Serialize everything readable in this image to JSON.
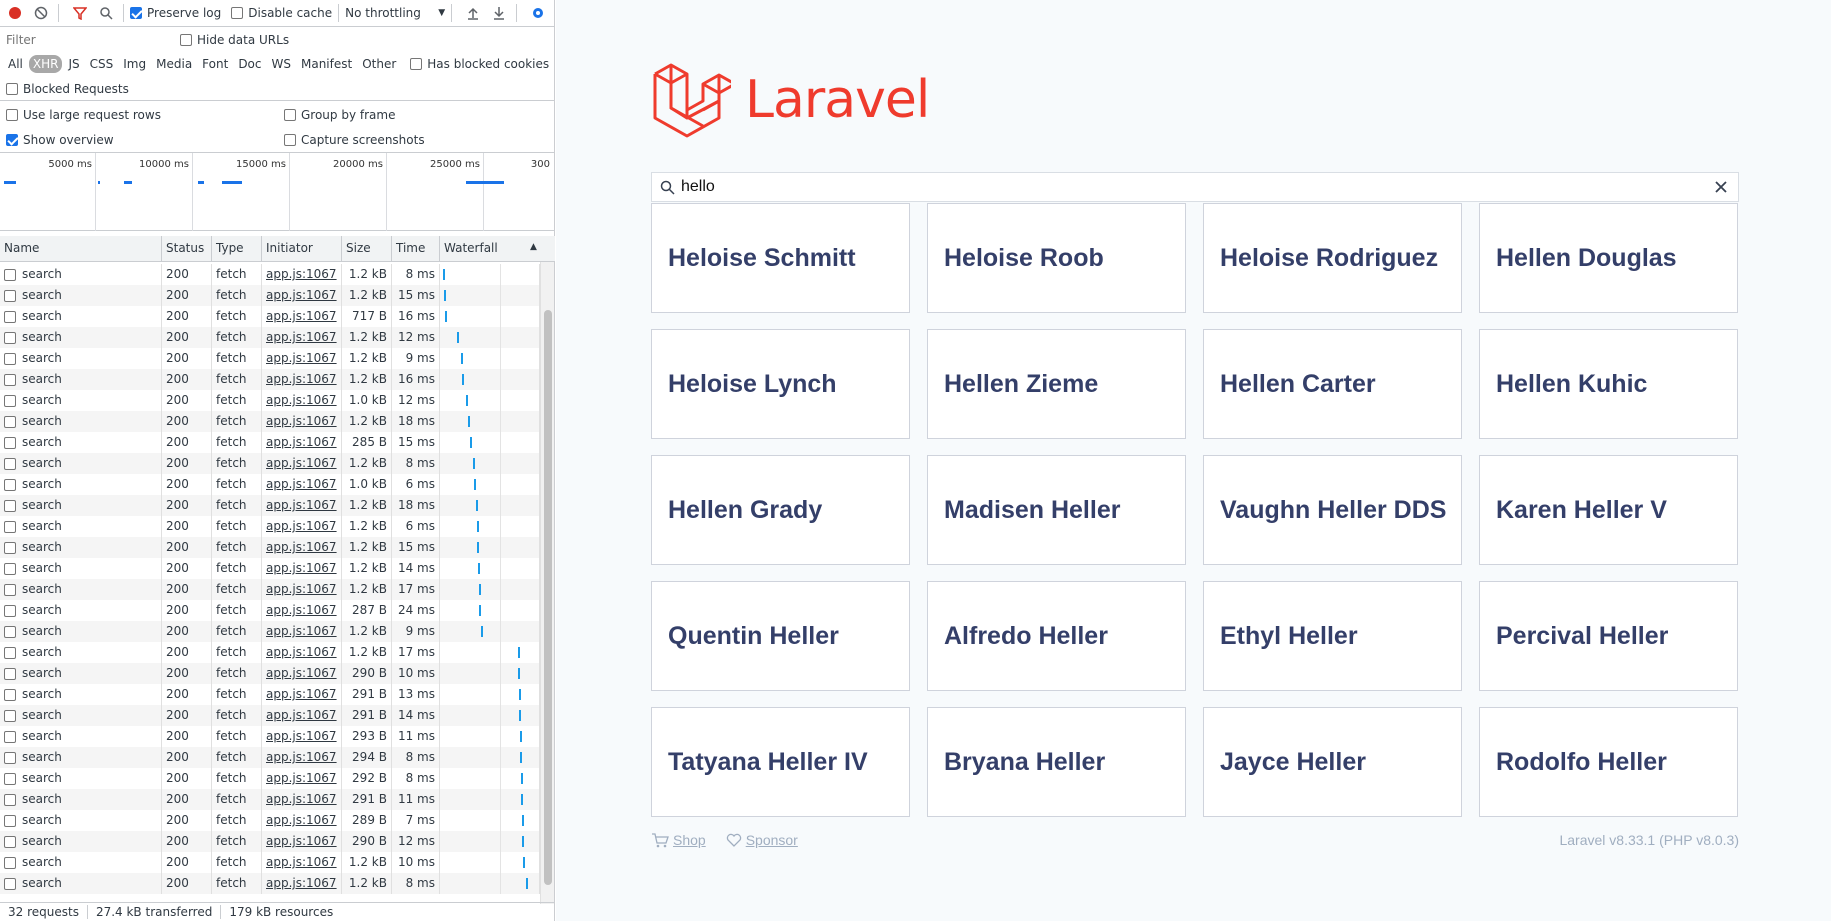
{
  "devtools": {
    "toolbar": {
      "preserve_log": "Preserve log",
      "disable_cache": "Disable cache",
      "throttling": "No throttling"
    },
    "filter": {
      "placeholder": "Filter",
      "hide_data_urls": "Hide data URLs",
      "types": [
        "All",
        "XHR",
        "JS",
        "CSS",
        "Img",
        "Media",
        "Font",
        "Doc",
        "WS",
        "Manifest",
        "Other"
      ],
      "active_type": "XHR",
      "has_blocked_cookies": "Has blocked cookies",
      "blocked_requests": "Blocked Requests"
    },
    "options": {
      "large_rows": "Use large request rows",
      "group_by_frame": "Group by frame",
      "show_overview": "Show overview",
      "capture_screenshots": "Capture screenshots"
    },
    "overview_labels": [
      "5000 ms",
      "10000 ms",
      "15000 ms",
      "20000 ms",
      "25000 ms",
      "300"
    ],
    "columns": [
      "Name",
      "Status",
      "Type",
      "Initiator",
      "Size",
      "Time",
      "Waterfall"
    ],
    "rows": [
      {
        "name": "search",
        "status": "200",
        "type": "fetch",
        "initiator": "app.js:1067",
        "size": "1.2 kB",
        "time": "8 ms",
        "wf": 0.03
      },
      {
        "name": "search",
        "status": "200",
        "type": "fetch",
        "initiator": "app.js:1067",
        "size": "1.2 kB",
        "time": "15 ms",
        "wf": 0.04
      },
      {
        "name": "search",
        "status": "200",
        "type": "fetch",
        "initiator": "app.js:1067",
        "size": "717 B",
        "time": "16 ms",
        "wf": 0.05
      },
      {
        "name": "search",
        "status": "200",
        "type": "fetch",
        "initiator": "app.js:1067",
        "size": "1.2 kB",
        "time": "12 ms",
        "wf": 0.18
      },
      {
        "name": "search",
        "status": "200",
        "type": "fetch",
        "initiator": "app.js:1067",
        "size": "1.2 kB",
        "time": "9 ms",
        "wf": 0.22
      },
      {
        "name": "search",
        "status": "200",
        "type": "fetch",
        "initiator": "app.js:1067",
        "size": "1.2 kB",
        "time": "16 ms",
        "wf": 0.23
      },
      {
        "name": "search",
        "status": "200",
        "type": "fetch",
        "initiator": "app.js:1067",
        "size": "1.0 kB",
        "time": "12 ms",
        "wf": 0.27
      },
      {
        "name": "search",
        "status": "200",
        "type": "fetch",
        "initiator": "app.js:1067",
        "size": "1.2 kB",
        "time": "18 ms",
        "wf": 0.29
      },
      {
        "name": "search",
        "status": "200",
        "type": "fetch",
        "initiator": "app.js:1067",
        "size": "285 B",
        "time": "15 ms",
        "wf": 0.31
      },
      {
        "name": "search",
        "status": "200",
        "type": "fetch",
        "initiator": "app.js:1067",
        "size": "1.2 kB",
        "time": "8 ms",
        "wf": 0.34
      },
      {
        "name": "search",
        "status": "200",
        "type": "fetch",
        "initiator": "app.js:1067",
        "size": "1.0 kB",
        "time": "6 ms",
        "wf": 0.35
      },
      {
        "name": "search",
        "status": "200",
        "type": "fetch",
        "initiator": "app.js:1067",
        "size": "1.2 kB",
        "time": "18 ms",
        "wf": 0.38
      },
      {
        "name": "search",
        "status": "200",
        "type": "fetch",
        "initiator": "app.js:1067",
        "size": "1.2 kB",
        "time": "6 ms",
        "wf": 0.39
      },
      {
        "name": "search",
        "status": "200",
        "type": "fetch",
        "initiator": "app.js:1067",
        "size": "1.2 kB",
        "time": "15 ms",
        "wf": 0.39
      },
      {
        "name": "search",
        "status": "200",
        "type": "fetch",
        "initiator": "app.js:1067",
        "size": "1.2 kB",
        "time": "14 ms",
        "wf": 0.4
      },
      {
        "name": "search",
        "status": "200",
        "type": "fetch",
        "initiator": "app.js:1067",
        "size": "1.2 kB",
        "time": "17 ms",
        "wf": 0.41
      },
      {
        "name": "search",
        "status": "200",
        "type": "fetch",
        "initiator": "app.js:1067",
        "size": "287 B",
        "time": "24 ms",
        "wf": 0.41
      },
      {
        "name": "search",
        "status": "200",
        "type": "fetch",
        "initiator": "app.js:1067",
        "size": "1.2 kB",
        "time": "9 ms",
        "wf": 0.43
      },
      {
        "name": "search",
        "status": "200",
        "type": "fetch",
        "initiator": "app.js:1067",
        "size": "1.2 kB",
        "time": "17 ms",
        "wf": 0.81
      },
      {
        "name": "search",
        "status": "200",
        "type": "fetch",
        "initiator": "app.js:1067",
        "size": "290 B",
        "time": "10 ms",
        "wf": 0.81
      },
      {
        "name": "search",
        "status": "200",
        "type": "fetch",
        "initiator": "app.js:1067",
        "size": "291 B",
        "time": "13 ms",
        "wf": 0.82
      },
      {
        "name": "search",
        "status": "200",
        "type": "fetch",
        "initiator": "app.js:1067",
        "size": "291 B",
        "time": "14 ms",
        "wf": 0.82
      },
      {
        "name": "search",
        "status": "200",
        "type": "fetch",
        "initiator": "app.js:1067",
        "size": "293 B",
        "time": "11 ms",
        "wf": 0.83
      },
      {
        "name": "search",
        "status": "200",
        "type": "fetch",
        "initiator": "app.js:1067",
        "size": "294 B",
        "time": "8 ms",
        "wf": 0.83
      },
      {
        "name": "search",
        "status": "200",
        "type": "fetch",
        "initiator": "app.js:1067",
        "size": "292 B",
        "time": "8 ms",
        "wf": 0.84
      },
      {
        "name": "search",
        "status": "200",
        "type": "fetch",
        "initiator": "app.js:1067",
        "size": "291 B",
        "time": "11 ms",
        "wf": 0.84
      },
      {
        "name": "search",
        "status": "200",
        "type": "fetch",
        "initiator": "app.js:1067",
        "size": "289 B",
        "time": "7 ms",
        "wf": 0.85
      },
      {
        "name": "search",
        "status": "200",
        "type": "fetch",
        "initiator": "app.js:1067",
        "size": "290 B",
        "time": "12 ms",
        "wf": 0.85
      },
      {
        "name": "search",
        "status": "200",
        "type": "fetch",
        "initiator": "app.js:1067",
        "size": "1.2 kB",
        "time": "10 ms",
        "wf": 0.86
      },
      {
        "name": "search",
        "status": "200",
        "type": "fetch",
        "initiator": "app.js:1067",
        "size": "1.2 kB",
        "time": "8 ms",
        "wf": 0.9
      }
    ],
    "status": {
      "requests": "32 requests",
      "transferred": "27.4 kB transferred",
      "resources": "179 kB resources"
    }
  },
  "app": {
    "logo_text": "Laravel",
    "brand_color": "#ef3b2d",
    "search_value": "hello",
    "results": [
      "Heloise Schmitt",
      "Heloise Roob",
      "Heloise Rodriguez",
      "Hellen Douglas",
      "Heloise Lynch",
      "Hellen Zieme",
      "Hellen Carter",
      "Hellen Kuhic",
      "Hellen Grady",
      "Madisen Heller",
      "Vaughn Heller DDS",
      "Karen Heller V",
      "Quentin Heller",
      "Alfredo Heller",
      "Ethyl Heller",
      "Percival Heller",
      "Tatyana Heller IV",
      "Bryana Heller",
      "Jayce Heller",
      "Rodolfo Heller"
    ],
    "footer": {
      "shop": "Shop",
      "sponsor": "Sponsor",
      "version": "Laravel v8.33.1 (PHP v8.0.3)"
    }
  }
}
